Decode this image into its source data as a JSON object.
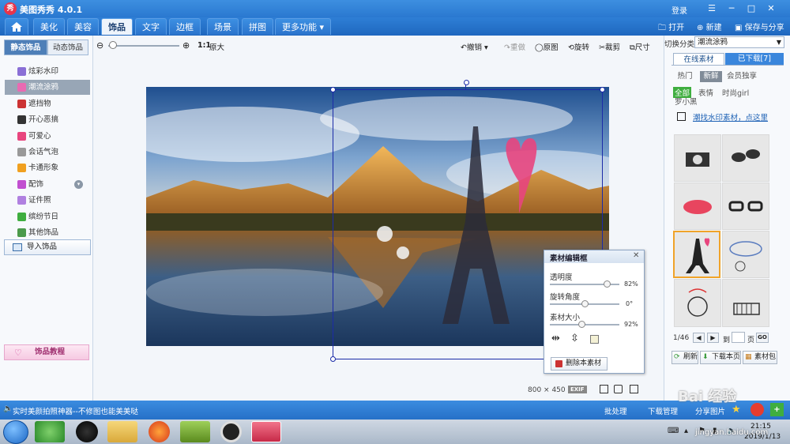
{
  "app": {
    "title": "美图秀秀 4.0.1",
    "logo_text": "秀",
    "login": "登录"
  },
  "window": {
    "menu_icon": "☰",
    "minimize": "─",
    "restore": "□",
    "close": "✕"
  },
  "menu": {
    "tabs": [
      "美化",
      "美容",
      "饰品",
      "文字",
      "边框",
      "场景",
      "拼图",
      "更多功能 ▾"
    ],
    "open": "打开",
    "new": "新建",
    "save_share": "保存与分享"
  },
  "left": {
    "tab_static": "静态饰品",
    "tab_dynamic": "动态饰品",
    "items": [
      "炫彩水印",
      "潮流涂鸦",
      "遮挡物",
      "开心恶搞",
      "可爱心",
      "会话气泡",
      "卡通形象",
      "配饰",
      "证件照",
      "缤纷节日",
      "其他饰品"
    ],
    "selected_index": 1,
    "import": "导入饰品",
    "tutorial": "饰品教程"
  },
  "toolbar": {
    "ratio": "1:1",
    "original_size": "原大",
    "undo": "撤销",
    "redo": "重做",
    "original": "原图",
    "rotate": "旋转",
    "crop": "裁剪",
    "size": "尺寸"
  },
  "canvas": {
    "size_text": "800 × 450",
    "exif": "EXIF"
  },
  "editor": {
    "title": "素材编辑框",
    "opacity_label": "透明度",
    "opacity_value": "82%",
    "opacity": 0.82,
    "rotation_label": "旋转角度",
    "rotation_value": "0°",
    "rotation": 0.5,
    "size_label": "素材大小",
    "size_value": "92%",
    "size": 0.46,
    "delete": "删除本素材"
  },
  "right": {
    "category_label": "切换分类",
    "category_value": "潮流涂鸦",
    "tab_online": "在线素材",
    "tab_downloaded": "已下载[7]",
    "filters": [
      "热门",
      "新鲜",
      "会员独享"
    ],
    "tags": [
      "全部",
      "表情",
      "时尚girl",
      "罗小黑"
    ],
    "find_link": "潮找水印素材，点这里",
    "pager": "1/46",
    "to_label": "到",
    "page_label": "页",
    "go": "GO",
    "refresh": "刷新",
    "download_page": "下载本页",
    "material_pack": "素材包"
  },
  "status": {
    "text": "实时美颜拍照神器--不修图也能美美哒",
    "batch": "批处理",
    "download_mgr": "下载管理",
    "share_pic": "分享图片"
  },
  "taskbar": {
    "time": "21:15",
    "date": "2019/1/13"
  },
  "watermark": {
    "brand": "Bai 经验",
    "url": "jingyan.baidu.com"
  },
  "colors": {
    "accent": "#2a78d0",
    "selection": "#1b2ba8",
    "heart": "#e8457e"
  }
}
